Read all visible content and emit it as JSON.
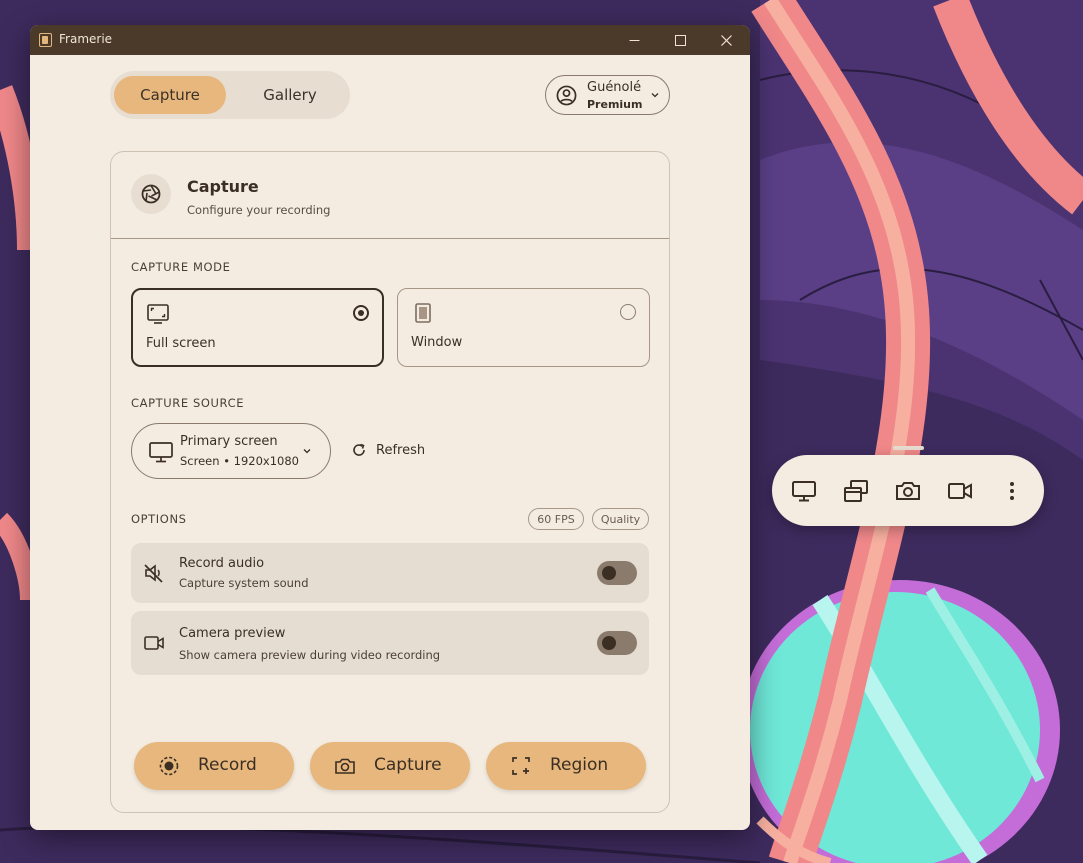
{
  "window": {
    "title": "Framerie"
  },
  "tabs": [
    {
      "label": "Capture"
    },
    {
      "label": "Gallery"
    }
  ],
  "account": {
    "name": "Guénolé",
    "plan": "Premium"
  },
  "card": {
    "title": "Capture",
    "subtitle": "Configure your recording"
  },
  "capture_mode": {
    "label": "CAPTURE MODE",
    "options": [
      {
        "label": "Full screen",
        "selected": true
      },
      {
        "label": "Window",
        "selected": false
      }
    ]
  },
  "capture_source": {
    "label": "CAPTURE SOURCE",
    "selected_name": "Primary screen",
    "selected_detail": "Screen • 1920x1080",
    "refresh_label": "Refresh"
  },
  "options": {
    "label": "OPTIONS",
    "chips": [
      "60 FPS",
      "Quality"
    ],
    "items": [
      {
        "title": "Record audio",
        "subtitle": "Capture system sound",
        "enabled": false
      },
      {
        "title": "Camera preview",
        "subtitle": "Show camera preview during video recording",
        "enabled": false
      }
    ]
  },
  "actions": [
    {
      "label": "Record"
    },
    {
      "label": "Capture"
    },
    {
      "label": "Region"
    }
  ],
  "colors": {
    "accent": "#e7b77d",
    "surface": "#f4ece1",
    "titlebar": "#4b3a29",
    "text": "#3b2f24"
  },
  "floating_toolbar": {
    "icons": [
      "monitor-icon",
      "windows-icon",
      "camera-icon",
      "video-icon",
      "more-vertical-icon"
    ]
  }
}
